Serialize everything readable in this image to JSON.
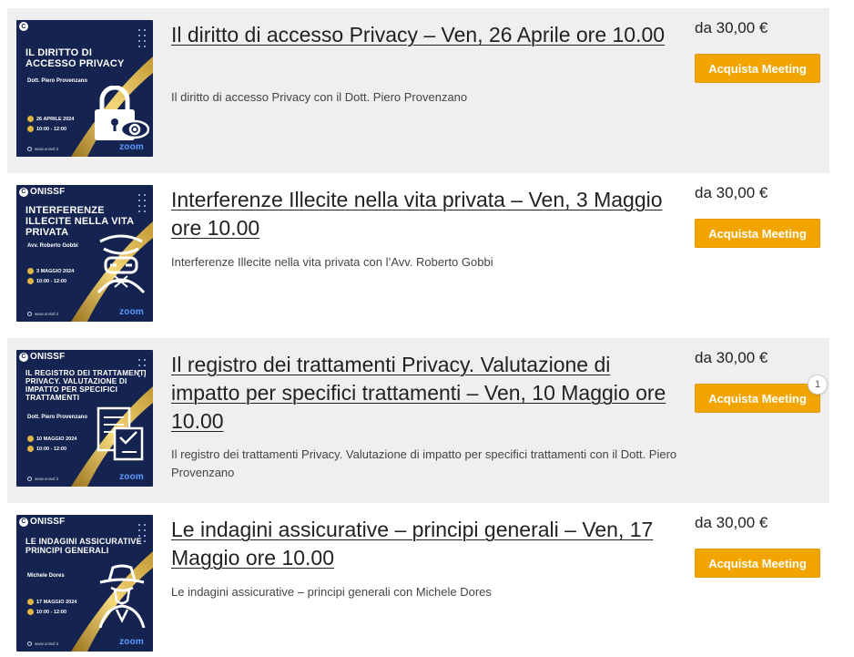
{
  "colors": {
    "accent_button": "#f2a500",
    "row_shade": "#efefef",
    "thumb_bg": "#14234f",
    "gold": "#e0b543"
  },
  "products": [
    {
      "title": "Il diritto di accesso Privacy – Ven, 26 Aprile ore 10.00",
      "description": "Il diritto di accesso Privacy con il Dott. Piero Provenzano",
      "price": "da 30,00 €",
      "button": "Acquista Meeting",
      "thumb": {
        "logo": "",
        "heading": "IL DIRITTO DI ACCESSO PRIVACY",
        "speaker": "Dott. Piero Provenzano",
        "date": "26 APRILE 2024",
        "time": "10:00 - 12:00",
        "site": "www.onissf.it",
        "zoom": "zoom",
        "icon": "lock-eye-icon"
      }
    },
    {
      "title": "Interferenze Illecite nella vita privata – Ven, 3 Maggio ore 10.00",
      "description": "Interferenze Illecite nella vita privata con l’Avv. Roberto Gobbi",
      "price": "da 30,00 €",
      "button": "Acquista Meeting",
      "thumb": {
        "logo": "ONISSF",
        "heading": "INTERFERENZE ILLECITE NELLA VITA PRIVATA",
        "speaker": "Avv. Roberto Gobbi",
        "date": "3 MAGGIO 2024",
        "time": "10:00 - 12:00",
        "site": "www.onissf.it",
        "zoom": "zoom",
        "icon": "hacker-icon"
      }
    },
    {
      "title": "Il registro dei trattamenti Privacy. Valutazione di impatto per specifici trattamenti – Ven, 10 Maggio ore 10.00",
      "description": "Il registro dei trattamenti Privacy. Valutazione di impatto per specifici trattamenti con il Dott. Piero Provenzano",
      "price": "da 30,00 €",
      "button": "Acquista Meeting",
      "badge": "1",
      "thumb": {
        "logo": "ONISSF",
        "heading": "IL REGISTRO DEI TRATTAMENTI PRIVACY. VALUTAZIONE DI IMPATTO PER SPECIFICI TRATTAMENTI",
        "speaker": "Dott. Piero Provenzano",
        "date": "10 MAGGIO 2024",
        "time": "10:00 - 12:00",
        "site": "www.onissf.it",
        "zoom": "zoom",
        "icon": "document-form-icon"
      }
    },
    {
      "title": "Le indagini assicurative – principi generali – Ven, 17 Maggio ore 10.00",
      "description": "Le indagini assicurative – principi generali con Michele Dores",
      "price": "da 30,00 €",
      "button": "Acquista Meeting",
      "thumb": {
        "logo": "ONISSF",
        "heading": "LE INDAGINI ASSICURATIVE PRINCIPI GENERALI",
        "speaker": "Michele Dores",
        "date": "17 MAGGIO 2024",
        "time": "10:00 - 12:00",
        "site": "www.onissf.it",
        "zoom": "zoom",
        "icon": "detective-icon"
      }
    }
  ]
}
